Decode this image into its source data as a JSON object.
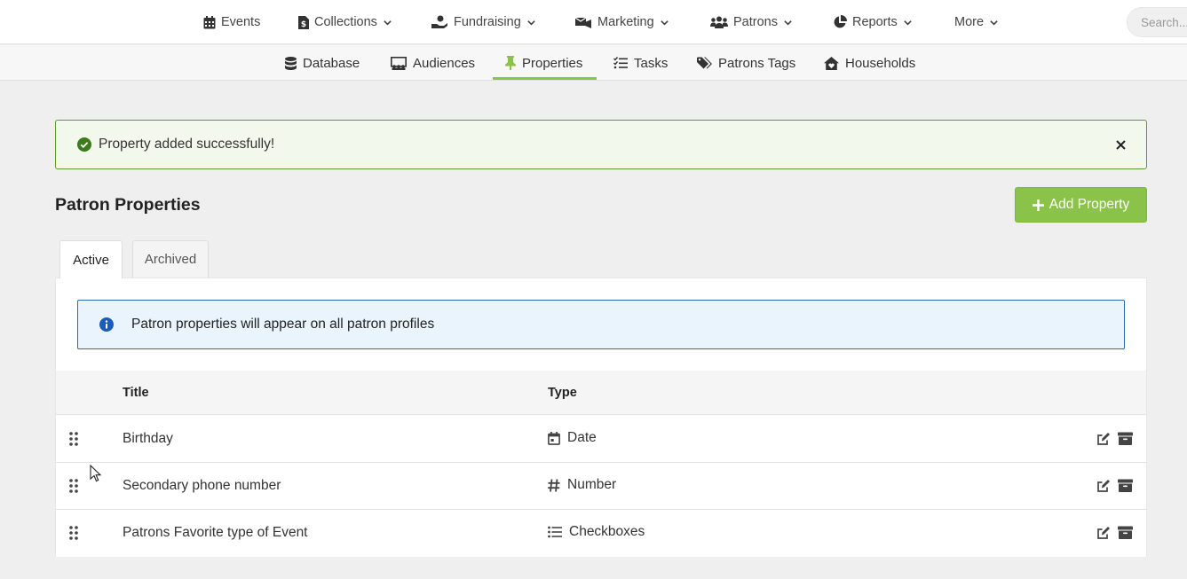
{
  "top_nav": {
    "items": [
      {
        "label": "Events",
        "icon": "calendar-icon"
      },
      {
        "label": "Collections",
        "icon": "dollar-file-icon"
      },
      {
        "label": "Fundraising",
        "icon": "hand-donation-icon"
      },
      {
        "label": "Marketing",
        "icon": "mail-bullhorn-icon"
      },
      {
        "label": "Patrons",
        "icon": "users-icon"
      },
      {
        "label": "Reports",
        "icon": "pie-chart-icon"
      },
      {
        "label": "More",
        "icon": ""
      }
    ],
    "search_placeholder": "Search..."
  },
  "sub_nav": {
    "items": [
      {
        "label": "Database",
        "icon": "database-icon"
      },
      {
        "label": "Audiences",
        "icon": "audience-icon"
      },
      {
        "label": "Properties",
        "icon": "thumbtack-icon",
        "active": true
      },
      {
        "label": "Tasks",
        "icon": "task-list-icon"
      },
      {
        "label": "Patrons Tags",
        "icon": "tags-icon"
      },
      {
        "label": "Households",
        "icon": "house-icon"
      }
    ]
  },
  "alert": {
    "message": "Property added successfully!",
    "color": "#5f9a2e"
  },
  "page": {
    "title": "Patron Properties",
    "add_button": "Add Property",
    "accent": "#8bc34a"
  },
  "tabs": {
    "active": "Active",
    "archived": "Archived"
  },
  "info_banner": {
    "message": "Patron properties will appear on all patron profiles"
  },
  "table": {
    "columns": {
      "title": "Title",
      "type": "Type"
    },
    "rows": [
      {
        "title": "Birthday",
        "type": "Date",
        "type_icon": "calendar-icon"
      },
      {
        "title": "Secondary phone number",
        "type": "Number",
        "type_icon": "hash-icon"
      },
      {
        "title": "Patrons Favorite type of Event",
        "type": "Checkboxes",
        "type_icon": "list-icon"
      }
    ]
  }
}
